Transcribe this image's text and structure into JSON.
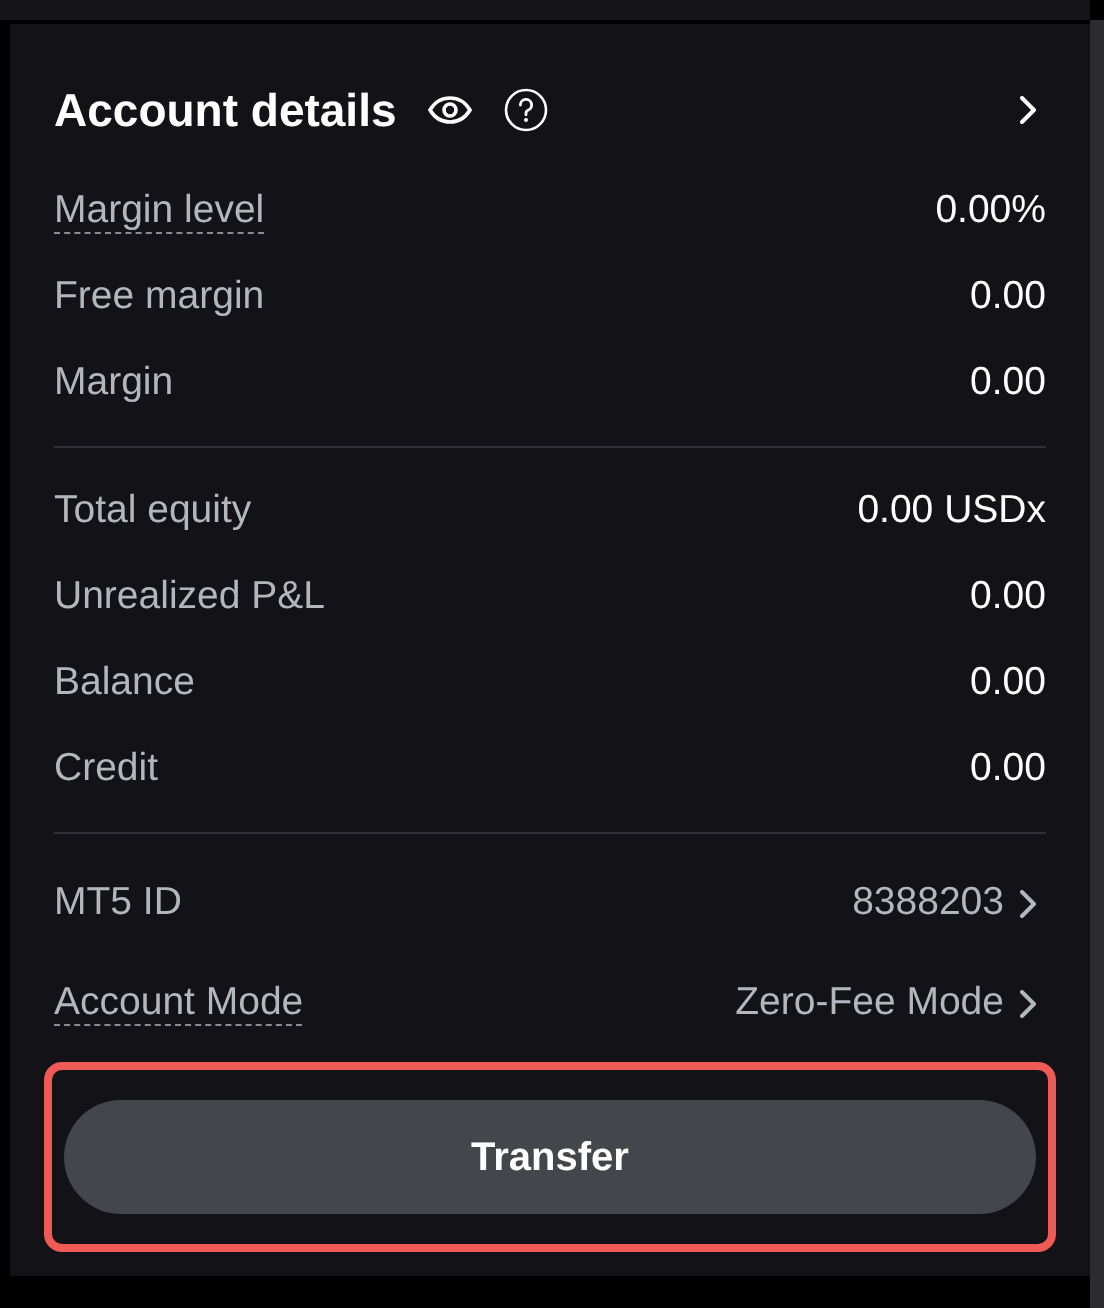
{
  "header": {
    "title": "Account details"
  },
  "groups": [
    {
      "rows": [
        {
          "label": "Margin level",
          "value": "0.00%",
          "dotted": true,
          "chevron": false
        },
        {
          "label": "Free margin",
          "value": "0.00",
          "dotted": false,
          "chevron": false
        },
        {
          "label": "Margin",
          "value": "0.00",
          "dotted": false,
          "chevron": false
        }
      ]
    },
    {
      "rows": [
        {
          "label": "Total equity",
          "value": "0.00 USDx",
          "dotted": false,
          "chevron": false
        },
        {
          "label": "Unrealized P&L",
          "value": "0.00",
          "dotted": false,
          "chevron": false
        },
        {
          "label": "Balance",
          "value": "0.00",
          "dotted": false,
          "chevron": false
        },
        {
          "label": "Credit",
          "value": "0.00",
          "dotted": false,
          "chevron": false
        }
      ]
    },
    {
      "rows": [
        {
          "label": "MT5 ID",
          "value": "8388203",
          "dotted": false,
          "chevron": true
        },
        {
          "label": "Account Mode",
          "value": "Zero-Fee Mode",
          "dotted": true,
          "chevron": true
        }
      ]
    }
  ],
  "button": {
    "label": "Transfer",
    "highlighted": true
  }
}
